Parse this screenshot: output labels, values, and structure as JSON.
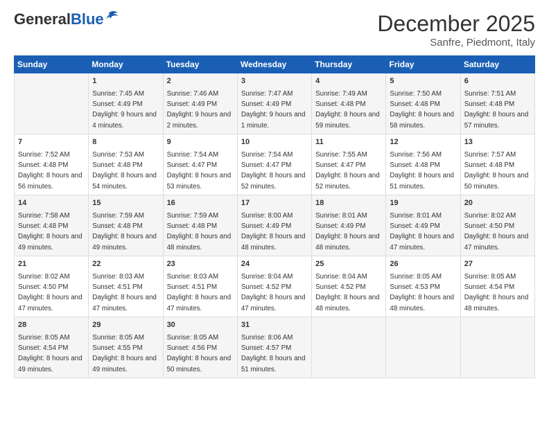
{
  "logo": {
    "general": "General",
    "blue": "Blue"
  },
  "header": {
    "month": "December 2025",
    "location": "Sanfre, Piedmont, Italy"
  },
  "days_of_week": [
    "Sunday",
    "Monday",
    "Tuesday",
    "Wednesday",
    "Thursday",
    "Friday",
    "Saturday"
  ],
  "weeks": [
    [
      {
        "day": "",
        "sunrise": "",
        "sunset": "",
        "daylight": ""
      },
      {
        "day": "1",
        "sunrise": "Sunrise: 7:45 AM",
        "sunset": "Sunset: 4:49 PM",
        "daylight": "Daylight: 9 hours and 4 minutes."
      },
      {
        "day": "2",
        "sunrise": "Sunrise: 7:46 AM",
        "sunset": "Sunset: 4:49 PM",
        "daylight": "Daylight: 9 hours and 2 minutes."
      },
      {
        "day": "3",
        "sunrise": "Sunrise: 7:47 AM",
        "sunset": "Sunset: 4:49 PM",
        "daylight": "Daylight: 9 hours and 1 minute."
      },
      {
        "day": "4",
        "sunrise": "Sunrise: 7:49 AM",
        "sunset": "Sunset: 4:48 PM",
        "daylight": "Daylight: 8 hours and 59 minutes."
      },
      {
        "day": "5",
        "sunrise": "Sunrise: 7:50 AM",
        "sunset": "Sunset: 4:48 PM",
        "daylight": "Daylight: 8 hours and 58 minutes."
      },
      {
        "day": "6",
        "sunrise": "Sunrise: 7:51 AM",
        "sunset": "Sunset: 4:48 PM",
        "daylight": "Daylight: 8 hours and 57 minutes."
      }
    ],
    [
      {
        "day": "7",
        "sunrise": "Sunrise: 7:52 AM",
        "sunset": "Sunset: 4:48 PM",
        "daylight": "Daylight: 8 hours and 56 minutes."
      },
      {
        "day": "8",
        "sunrise": "Sunrise: 7:53 AM",
        "sunset": "Sunset: 4:48 PM",
        "daylight": "Daylight: 8 hours and 54 minutes."
      },
      {
        "day": "9",
        "sunrise": "Sunrise: 7:54 AM",
        "sunset": "Sunset: 4:47 PM",
        "daylight": "Daylight: 8 hours and 53 minutes."
      },
      {
        "day": "10",
        "sunrise": "Sunrise: 7:54 AM",
        "sunset": "Sunset: 4:47 PM",
        "daylight": "Daylight: 8 hours and 52 minutes."
      },
      {
        "day": "11",
        "sunrise": "Sunrise: 7:55 AM",
        "sunset": "Sunset: 4:47 PM",
        "daylight": "Daylight: 8 hours and 52 minutes."
      },
      {
        "day": "12",
        "sunrise": "Sunrise: 7:56 AM",
        "sunset": "Sunset: 4:48 PM",
        "daylight": "Daylight: 8 hours and 51 minutes."
      },
      {
        "day": "13",
        "sunrise": "Sunrise: 7:57 AM",
        "sunset": "Sunset: 4:48 PM",
        "daylight": "Daylight: 8 hours and 50 minutes."
      }
    ],
    [
      {
        "day": "14",
        "sunrise": "Sunrise: 7:58 AM",
        "sunset": "Sunset: 4:48 PM",
        "daylight": "Daylight: 8 hours and 49 minutes."
      },
      {
        "day": "15",
        "sunrise": "Sunrise: 7:59 AM",
        "sunset": "Sunset: 4:48 PM",
        "daylight": "Daylight: 8 hours and 49 minutes."
      },
      {
        "day": "16",
        "sunrise": "Sunrise: 7:59 AM",
        "sunset": "Sunset: 4:48 PM",
        "daylight": "Daylight: 8 hours and 48 minutes."
      },
      {
        "day": "17",
        "sunrise": "Sunrise: 8:00 AM",
        "sunset": "Sunset: 4:49 PM",
        "daylight": "Daylight: 8 hours and 48 minutes."
      },
      {
        "day": "18",
        "sunrise": "Sunrise: 8:01 AM",
        "sunset": "Sunset: 4:49 PM",
        "daylight": "Daylight: 8 hours and 48 minutes."
      },
      {
        "day": "19",
        "sunrise": "Sunrise: 8:01 AM",
        "sunset": "Sunset: 4:49 PM",
        "daylight": "Daylight: 8 hours and 47 minutes."
      },
      {
        "day": "20",
        "sunrise": "Sunrise: 8:02 AM",
        "sunset": "Sunset: 4:50 PM",
        "daylight": "Daylight: 8 hours and 47 minutes."
      }
    ],
    [
      {
        "day": "21",
        "sunrise": "Sunrise: 8:02 AM",
        "sunset": "Sunset: 4:50 PM",
        "daylight": "Daylight: 8 hours and 47 minutes."
      },
      {
        "day": "22",
        "sunrise": "Sunrise: 8:03 AM",
        "sunset": "Sunset: 4:51 PM",
        "daylight": "Daylight: 8 hours and 47 minutes."
      },
      {
        "day": "23",
        "sunrise": "Sunrise: 8:03 AM",
        "sunset": "Sunset: 4:51 PM",
        "daylight": "Daylight: 8 hours and 47 minutes."
      },
      {
        "day": "24",
        "sunrise": "Sunrise: 8:04 AM",
        "sunset": "Sunset: 4:52 PM",
        "daylight": "Daylight: 8 hours and 47 minutes."
      },
      {
        "day": "25",
        "sunrise": "Sunrise: 8:04 AM",
        "sunset": "Sunset: 4:52 PM",
        "daylight": "Daylight: 8 hours and 48 minutes."
      },
      {
        "day": "26",
        "sunrise": "Sunrise: 8:05 AM",
        "sunset": "Sunset: 4:53 PM",
        "daylight": "Daylight: 8 hours and 48 minutes."
      },
      {
        "day": "27",
        "sunrise": "Sunrise: 8:05 AM",
        "sunset": "Sunset: 4:54 PM",
        "daylight": "Daylight: 8 hours and 48 minutes."
      }
    ],
    [
      {
        "day": "28",
        "sunrise": "Sunrise: 8:05 AM",
        "sunset": "Sunset: 4:54 PM",
        "daylight": "Daylight: 8 hours and 49 minutes."
      },
      {
        "day": "29",
        "sunrise": "Sunrise: 8:05 AM",
        "sunset": "Sunset: 4:55 PM",
        "daylight": "Daylight: 8 hours and 49 minutes."
      },
      {
        "day": "30",
        "sunrise": "Sunrise: 8:05 AM",
        "sunset": "Sunset: 4:56 PM",
        "daylight": "Daylight: 8 hours and 50 minutes."
      },
      {
        "day": "31",
        "sunrise": "Sunrise: 8:06 AM",
        "sunset": "Sunset: 4:57 PM",
        "daylight": "Daylight: 8 hours and 51 minutes."
      },
      {
        "day": "",
        "sunrise": "",
        "sunset": "",
        "daylight": ""
      },
      {
        "day": "",
        "sunrise": "",
        "sunset": "",
        "daylight": ""
      },
      {
        "day": "",
        "sunrise": "",
        "sunset": "",
        "daylight": ""
      }
    ]
  ]
}
